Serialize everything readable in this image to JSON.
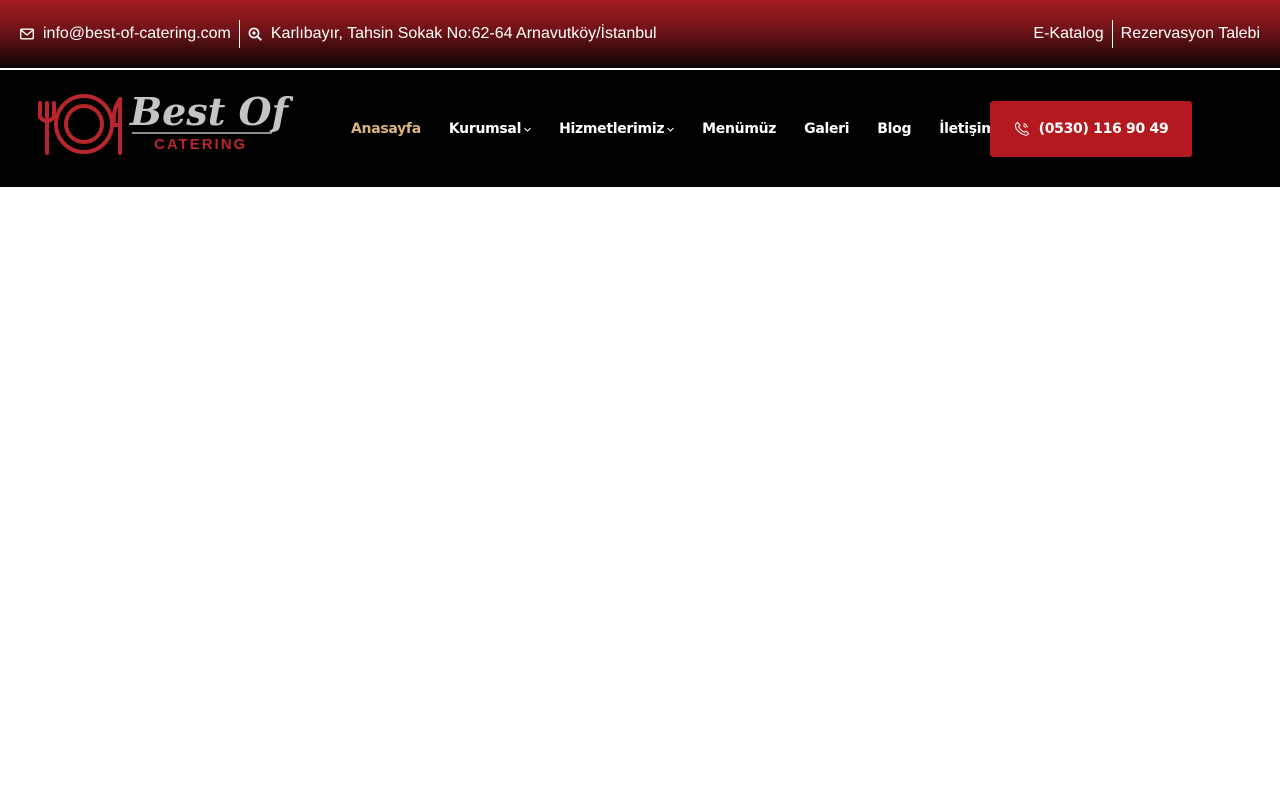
{
  "topbar": {
    "email": "info@best-of-catering.com",
    "address": "Karlıbayır, Tahsin Sokak No:62-64 Arnavutköy/İstanbul",
    "links": [
      "E-Katalog",
      "Rezervasyon Talebi"
    ],
    "icons": {
      "email": "envelope-icon",
      "address": "map-search-icon"
    }
  },
  "logo": {
    "title": "Best Of",
    "subtitle": "CATERING",
    "colors": {
      "accent": "#b8262b",
      "title": "#c4c4c4"
    }
  },
  "nav": {
    "items": [
      {
        "label": "Anasayfa",
        "active": true
      },
      {
        "label": "Kurumsal",
        "dropdown": true
      },
      {
        "label": "Hizmetlerimiz",
        "dropdown": true
      },
      {
        "label": "Menümüz"
      },
      {
        "label": "Galeri"
      },
      {
        "label": "Blog"
      },
      {
        "label": "İletişim"
      }
    ],
    "active_color": "#d8b47a"
  },
  "cta": {
    "phone": "(0530) 116 90 49",
    "icon": "phone-icon",
    "color": "#b3191f"
  }
}
